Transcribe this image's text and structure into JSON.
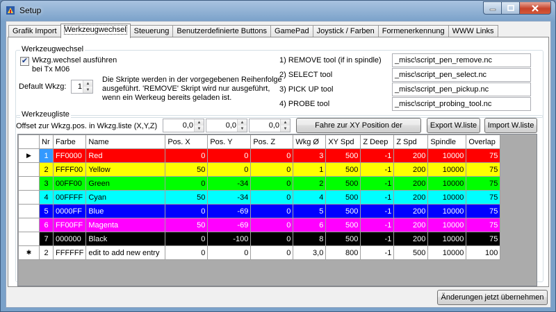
{
  "window": {
    "title": "Setup"
  },
  "tabs": [
    {
      "label": "Grafik Import",
      "active": false
    },
    {
      "label": "Werkzeugwechsel",
      "active": true
    },
    {
      "label": "Steuerung",
      "active": false
    },
    {
      "label": "Benutzerdefinierte Buttons",
      "active": false
    },
    {
      "label": "GamePad",
      "active": false
    },
    {
      "label": "Joystick / Farben",
      "active": false
    },
    {
      "label": "Formenerkennung",
      "active": false
    },
    {
      "label": "WWW Links",
      "active": false
    }
  ],
  "toolchange": {
    "legend": "Werkzeugwechsel",
    "execute_checkbox": {
      "label_line1": "Wkzg.wechsel ausführen",
      "label_line2": "bei Tx M06",
      "checked": true,
      "check_glyph": "✔"
    },
    "default_label": "Default Wkzg:",
    "default_value": "1",
    "info_line1": "Die Skripte werden in der vorgegebenen Reihenfolge",
    "info_line2": "ausgeführt. 'REMOVE' Skript wird nur ausgeführt,",
    "info_line3": "wenn ein Werkeug bereits geladen ist.",
    "scripts": [
      {
        "label": "1) REMOVE tool (if in spindle)",
        "value": "_misc\\script_pen_remove.nc"
      },
      {
        "label": "2) SELECT tool",
        "value": "_misc\\script_pen_select.nc"
      },
      {
        "label": "3) PICK UP tool",
        "value": "_misc\\script_pen_pickup.nc"
      },
      {
        "label": "4) PROBE tool",
        "value": "_misc\\script_probing_tool.nc"
      }
    ]
  },
  "toollist": {
    "legend": "Werkzeugliste",
    "offset_label": "Offset zur Wkzg.pos. in Wkzg.liste (X,Y,Z)",
    "offset_x": "0,0",
    "offset_y": "0,0",
    "offset_z": "0,0",
    "goto_button": "Fahre zur XY Position der",
    "export_button": "Export W.liste",
    "import_button": "Import W.liste",
    "columns": [
      "Nr",
      "Farbe",
      "Name",
      "Pos. X",
      "Pos. Y",
      "Pos. Z",
      "Wkg Ø",
      "XY Spd",
      "Z Deep",
      "Z Spd",
      "Spindle",
      "Overlap"
    ],
    "current_row_glyph": "▶",
    "new_row_glyph": "✱",
    "rows": [
      {
        "nr": "1",
        "farbe": "FF0000",
        "name": "Red",
        "posx": "0",
        "posy": "0",
        "posz": "0",
        "wkg": "3",
        "xyspd": "500",
        "zdeep": "-1",
        "zspd": "200",
        "spindle": "10000",
        "overlap": "75",
        "bg": "#ff0000",
        "fg": "#ffffff",
        "nrbg": "#3399ff"
      },
      {
        "nr": "2",
        "farbe": "FFFF00",
        "name": "Yellow",
        "posx": "50",
        "posy": "0",
        "posz": "0",
        "wkg": "1",
        "xyspd": "500",
        "zdeep": "-1",
        "zspd": "200",
        "spindle": "10000",
        "overlap": "75",
        "bg": "#ffff00",
        "fg": "#000000",
        "nrbg": "#ffff00"
      },
      {
        "nr": "3",
        "farbe": "00FF00",
        "name": "Green",
        "posx": "0",
        "posy": "-34",
        "posz": "0",
        "wkg": "2",
        "xyspd": "500",
        "zdeep": "-1",
        "zspd": "200",
        "spindle": "10000",
        "overlap": "75",
        "bg": "#00ff00",
        "fg": "#000000",
        "nrbg": "#00ff00"
      },
      {
        "nr": "4",
        "farbe": "00FFFF",
        "name": "Cyan",
        "posx": "50",
        "posy": "-34",
        "posz": "0",
        "wkg": "4",
        "xyspd": "500",
        "zdeep": "-1",
        "zspd": "200",
        "spindle": "10000",
        "overlap": "75",
        "bg": "#00ffff",
        "fg": "#000000",
        "nrbg": "#00ffff"
      },
      {
        "nr": "5",
        "farbe": "0000FF",
        "name": "Blue",
        "posx": "0",
        "posy": "-69",
        "posz": "0",
        "wkg": "5",
        "xyspd": "500",
        "zdeep": "-1",
        "zspd": "200",
        "spindle": "10000",
        "overlap": "75",
        "bg": "#0000ff",
        "fg": "#ffffff",
        "nrbg": "#0000ff"
      },
      {
        "nr": "6",
        "farbe": "FF00FF",
        "name": "Magenta",
        "posx": "50",
        "posy": "-69",
        "posz": "0",
        "wkg": "6",
        "xyspd": "500",
        "zdeep": "-1",
        "zspd": "200",
        "spindle": "10000",
        "overlap": "75",
        "bg": "#ff00ff",
        "fg": "#ffffff",
        "nrbg": "#ff00ff"
      },
      {
        "nr": "7",
        "farbe": "000000",
        "name": "Black",
        "posx": "0",
        "posy": "-100",
        "posz": "0",
        "wkg": "8",
        "xyspd": "500",
        "zdeep": "-1",
        "zspd": "200",
        "spindle": "10000",
        "overlap": "75",
        "bg": "#000000",
        "fg": "#ffffff",
        "nrbg": "#000000"
      }
    ],
    "new_row": {
      "nr": "2",
      "farbe": "FFFFFF",
      "name": "edit to add new entry",
      "posx": "0",
      "posy": "0",
      "posz": "0",
      "wkg": "3,0",
      "xyspd": "800",
      "zdeep": "-1",
      "zspd": "500",
      "spindle": "10000",
      "overlap": "100"
    }
  },
  "apply_button": "Änderungen jetzt übernehmen",
  "colors": {
    "grid_background": "#ababab",
    "selection": "#3399ff"
  }
}
